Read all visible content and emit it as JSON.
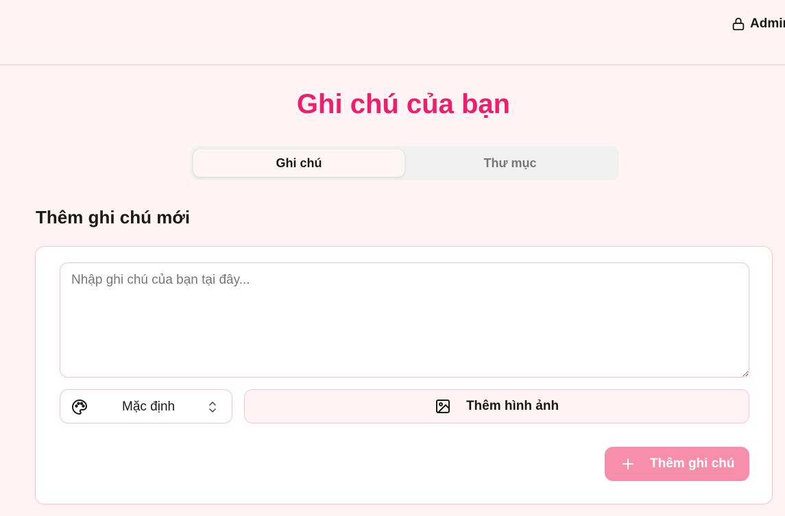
{
  "header": {
    "admin_label": "Admin",
    "admin_icon": "lock-icon"
  },
  "page": {
    "title": "Ghi chú của bạn"
  },
  "tabs": [
    {
      "label": "Ghi chú",
      "active": true
    },
    {
      "label": "Thư mục",
      "active": false
    }
  ],
  "new_note": {
    "section_title": "Thêm ghi chú mới",
    "textarea_placeholder": "Nhập ghi chú của bạn tại đây...",
    "textarea_value": "",
    "color_select": {
      "value": "Mặc định",
      "icon": "palette-icon"
    },
    "add_image_label": "Thêm hình ảnh",
    "add_image_icon": "image-icon",
    "submit_label": "Thêm ghi chú",
    "submit_icon": "plus-icon"
  },
  "colors": {
    "accent": "#ee1f6a",
    "button_disabled": "#f78fac",
    "background": "#fff3f5",
    "border": "#f3c1cf"
  }
}
